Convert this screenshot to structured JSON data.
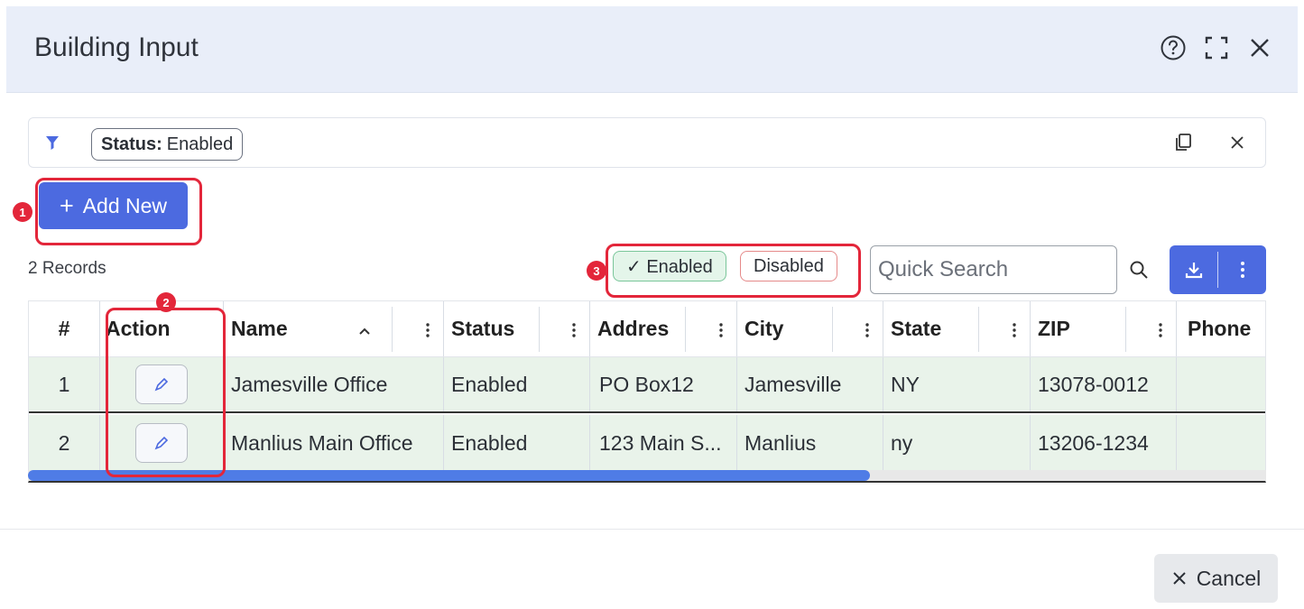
{
  "dialog": {
    "title": "Building Input",
    "help_icon": "help-circle-icon",
    "expand_icon": "fullscreen-icon",
    "close_icon": "close-icon"
  },
  "filter_bar": {
    "chip_key": "Status:",
    "chip_value": "Enabled",
    "filter_icon": "funnel-icon",
    "copy_icon": "copy-icon",
    "clear_icon": "close-icon"
  },
  "toolbar": {
    "add_label": "Add New",
    "records_label": "2 Records",
    "enabled_toggle": "✓ Enabled",
    "disabled_toggle": "Disabled",
    "search_placeholder": "Quick Search",
    "accent_color": "#4c6ae0"
  },
  "table": {
    "columns": [
      "#",
      "Action",
      "Name",
      "Status",
      "Addres",
      "City",
      "State",
      "ZIP",
      "Phone"
    ],
    "sorted_column": "Name",
    "sort_direction": "ascending",
    "rows": [
      {
        "num": "1",
        "name": "Jamesville Office",
        "status": "Enabled",
        "address": "PO Box12",
        "city": "Jamesville",
        "state": "NY",
        "zip": "13078-0012",
        "phone": ""
      },
      {
        "num": "2",
        "name": "Manlius Main Office",
        "status": "Enabled",
        "address": "123 Main S...",
        "city": "Manlius",
        "state": "ny",
        "zip": "13206-1234",
        "phone": ""
      }
    ],
    "row_color": "#e9f3ea"
  },
  "annotations": [
    "1",
    "2",
    "3"
  ],
  "annotation_color": "#e3263a",
  "footer": {
    "cancel_label": "Cancel"
  }
}
